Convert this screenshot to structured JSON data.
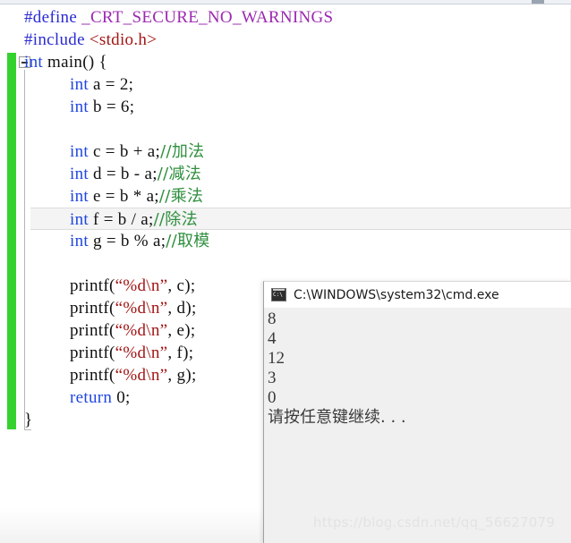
{
  "app": {
    "type": "code-editor-with-console"
  },
  "editor": {
    "lines": [
      {
        "indent": 0,
        "segments": [
          {
            "cls": "tok-pre",
            "text": "#define"
          },
          {
            "cls": "tok-plain",
            "text": " "
          },
          {
            "cls": "tok-macro",
            "text": "_CRT_SECURE_NO_WARNINGS"
          }
        ]
      },
      {
        "indent": 0,
        "segments": [
          {
            "cls": "tok-pre",
            "text": "#include"
          },
          {
            "cls": "tok-plain",
            "text": " "
          },
          {
            "cls": "tok-header",
            "text": "<stdio.h>"
          }
        ]
      },
      {
        "indent": 0,
        "segments": [
          {
            "cls": "tok-kw",
            "text": "int"
          },
          {
            "cls": "tok-plain",
            "text": " main() {"
          }
        ]
      },
      {
        "indent": 1,
        "segments": [
          {
            "cls": "tok-kw",
            "text": "int"
          },
          {
            "cls": "tok-plain",
            "text": " a = 2;"
          }
        ]
      },
      {
        "indent": 1,
        "segments": [
          {
            "cls": "tok-kw",
            "text": "int"
          },
          {
            "cls": "tok-plain",
            "text": " b = 6;"
          }
        ]
      },
      {
        "indent": 1,
        "segments": []
      },
      {
        "indent": 1,
        "segments": [
          {
            "cls": "tok-kw",
            "text": "int"
          },
          {
            "cls": "tok-plain",
            "text": " c = b + a;"
          },
          {
            "cls": "tok-cmt cjk",
            "text": "//加法"
          }
        ]
      },
      {
        "indent": 1,
        "segments": [
          {
            "cls": "tok-kw",
            "text": "int"
          },
          {
            "cls": "tok-plain",
            "text": " d = b - a;"
          },
          {
            "cls": "tok-cmt cjk",
            "text": "//减法"
          }
        ]
      },
      {
        "indent": 1,
        "segments": [
          {
            "cls": "tok-kw",
            "text": "int"
          },
          {
            "cls": "tok-plain",
            "text": " e = b * a;"
          },
          {
            "cls": "tok-cmt cjk",
            "text": "//乘法"
          }
        ]
      },
      {
        "indent": 1,
        "current": true,
        "segments": [
          {
            "cls": "tok-kw",
            "text": "int"
          },
          {
            "cls": "tok-plain",
            "text": " f = b / a;"
          },
          {
            "cls": "tok-cmt cjk",
            "text": "//除法"
          }
        ]
      },
      {
        "indent": 1,
        "segments": [
          {
            "cls": "tok-kw",
            "text": "int"
          },
          {
            "cls": "tok-plain",
            "text": " g = b % a;"
          },
          {
            "cls": "tok-cmt cjk",
            "text": "//取模"
          }
        ]
      },
      {
        "indent": 1,
        "segments": []
      },
      {
        "indent": 1,
        "segments": [
          {
            "cls": "tok-plain",
            "text": "printf("
          },
          {
            "cls": "tok-str",
            "text": "“%d\\n”"
          },
          {
            "cls": "tok-plain",
            "text": ", c);"
          }
        ]
      },
      {
        "indent": 1,
        "segments": [
          {
            "cls": "tok-plain",
            "text": "printf("
          },
          {
            "cls": "tok-str",
            "text": "“%d\\n”"
          },
          {
            "cls": "tok-plain",
            "text": ", d);"
          }
        ]
      },
      {
        "indent": 1,
        "segments": [
          {
            "cls": "tok-plain",
            "text": "printf("
          },
          {
            "cls": "tok-str",
            "text": "“%d\\n”"
          },
          {
            "cls": "tok-plain",
            "text": ", e);"
          }
        ]
      },
      {
        "indent": 1,
        "segments": [
          {
            "cls": "tok-plain",
            "text": "printf("
          },
          {
            "cls": "tok-str",
            "text": "“%d\\n”"
          },
          {
            "cls": "tok-plain",
            "text": ", f);"
          }
        ]
      },
      {
        "indent": 1,
        "segments": [
          {
            "cls": "tok-plain",
            "text": "printf("
          },
          {
            "cls": "tok-str",
            "text": "“%d\\n”"
          },
          {
            "cls": "tok-plain",
            "text": ", g);"
          }
        ]
      },
      {
        "indent": 1,
        "segments": [
          {
            "cls": "tok-kw",
            "text": "return"
          },
          {
            "cls": "tok-plain",
            "text": " 0;"
          }
        ]
      },
      {
        "indent": 0,
        "segments": [
          {
            "cls": "tok-plain",
            "text": "}"
          }
        ]
      }
    ],
    "collapse_icon": "collapse-minus-icon",
    "change_bar_color": "#35d22e"
  },
  "console": {
    "title": "C:\\WINDOWS\\system32\\cmd.exe",
    "icon": "cmd-window-icon",
    "output": [
      "8",
      "4",
      "12",
      "3",
      "0"
    ],
    "prompt": "请按任意键继续. . ."
  },
  "watermark": {
    "text": "https://blog.csdn.net/qq_56627079"
  }
}
